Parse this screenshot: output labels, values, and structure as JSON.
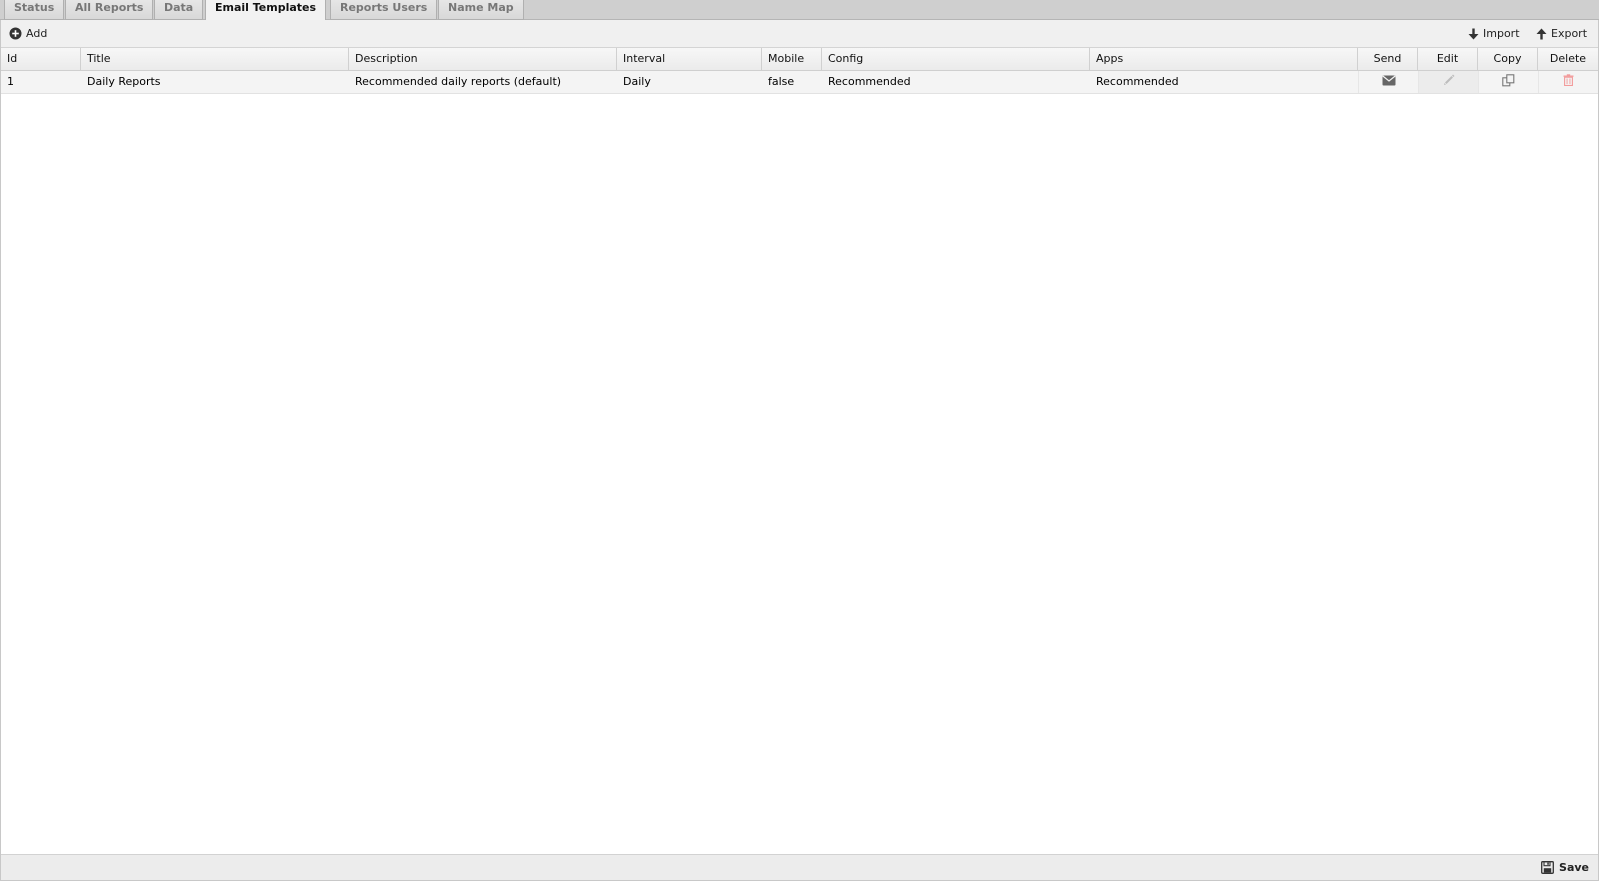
{
  "tabs": [
    {
      "label": "Status"
    },
    {
      "label": "All Reports"
    },
    {
      "label": "Data"
    },
    {
      "label": "Email Templates"
    },
    {
      "label": "Reports Users"
    },
    {
      "label": "Name Map"
    }
  ],
  "toolbar": {
    "add_label": "Add",
    "import_label": "Import",
    "export_label": "Export"
  },
  "grid": {
    "columns": [
      "Id",
      "Title",
      "Description",
      "Interval",
      "Mobile",
      "Config",
      "Apps",
      "Send",
      "Edit",
      "Copy",
      "Delete"
    ],
    "rows": [
      {
        "id": "1",
        "title": "Daily Reports",
        "description": "Recommended daily reports (default)",
        "interval": "Daily",
        "mobile": "false",
        "config": "Recommended",
        "apps": "Recommended"
      }
    ]
  },
  "footer": {
    "save_label": "Save"
  },
  "colors": {
    "delete_icon": "#f29a9a",
    "icon_gray": "#777777",
    "active_tab_text": "#111111"
  }
}
